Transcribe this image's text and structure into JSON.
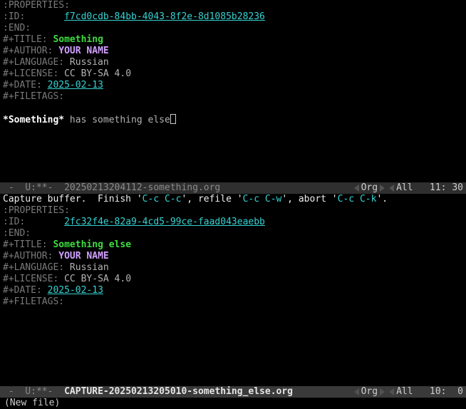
{
  "buffer1": {
    "properties_open": ":PROPERTIES:",
    "id_label": ":ID:",
    "id_value": "f7cd0cdb-84bb-4043-8f2e-8d1085b28236",
    "end": ":END:",
    "title_label": "#+TITLE:",
    "title_value": "Something",
    "author_label": "#+AUTHOR:",
    "author_value": "YOUR NAME",
    "language_label": "#+LANGUAGE:",
    "language_value": "Russian",
    "license_label": "#+LICENSE:",
    "license_value": "CC BY-SA 4.0",
    "date_label": "#+DATE:",
    "date_value": "2025-02-13",
    "filetags_label": "#+FILETAGS:",
    "body_bold": "*Something*",
    "body_rest": " has something else"
  },
  "capture_hint": {
    "prefix": "Capture buffer.  Finish '",
    "k1": "C-c C-c",
    "mid1": "', refile '",
    "k2": "C-c C-w",
    "mid2": "', abort '",
    "k3": "C-c C-k",
    "suffix": "'."
  },
  "buffer2": {
    "properties_open": ":PROPERTIES:",
    "id_label": ":ID:",
    "id_value": "2fc32f4e-82a9-4cd5-99ce-faad043eaebb",
    "end": ":END:",
    "title_label": "#+TITLE:",
    "title_value": "Something else",
    "author_label": "#+AUTHOR:",
    "author_value": "YOUR NAME",
    "language_label": "#+LANGUAGE:",
    "language_value": "Russian",
    "license_label": "#+LICENSE:",
    "license_value": "CC BY-SA 4.0",
    "date_label": "#+DATE:",
    "date_value": "2025-02-13",
    "filetags_label": "#+FILETAGS:"
  },
  "modeline1": {
    "left": " -  U:**- ",
    "file": " 20250213204112-something.org",
    "mode": "Org",
    "pos": "All",
    "loc": "11: 30"
  },
  "modeline2": {
    "left": " -  U:**- ",
    "file": " CAPTURE-20250213205010-something_else.org",
    "mode": "Org",
    "pos": "All",
    "loc": "10:  0"
  },
  "echo": "(New file)"
}
